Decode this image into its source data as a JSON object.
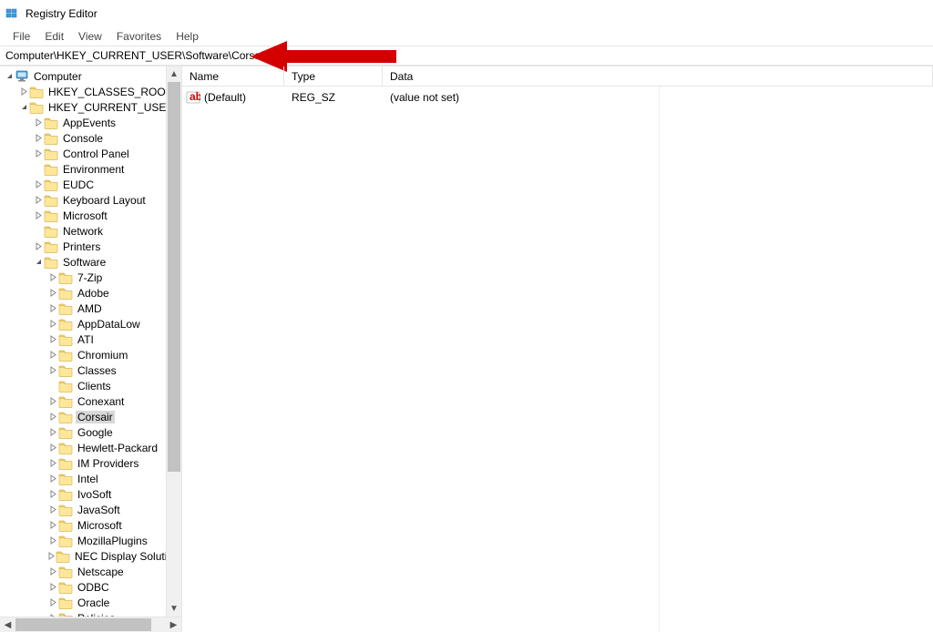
{
  "titlebar": {
    "title": "Registry Editor"
  },
  "menubar": {
    "file": "File",
    "edit": "Edit",
    "view": "View",
    "favorites": "Favorites",
    "help": "Help"
  },
  "addressbar": {
    "path": "Computer\\HKEY_CURRENT_USER\\Software\\Corsair"
  },
  "tree": [
    {
      "level": 0,
      "exp": "v",
      "icon": "computer",
      "label": "Computer"
    },
    {
      "level": 1,
      "exp": ">",
      "icon": "folder",
      "label": "HKEY_CLASSES_ROOT"
    },
    {
      "level": 1,
      "exp": "v",
      "icon": "folder",
      "label": "HKEY_CURRENT_USER"
    },
    {
      "level": 2,
      "exp": ">",
      "icon": "folder",
      "label": "AppEvents"
    },
    {
      "level": 2,
      "exp": ">",
      "icon": "folder",
      "label": "Console"
    },
    {
      "level": 2,
      "exp": ">",
      "icon": "folder",
      "label": "Control Panel"
    },
    {
      "level": 2,
      "exp": " ",
      "icon": "folder",
      "label": "Environment"
    },
    {
      "level": 2,
      "exp": ">",
      "icon": "folder",
      "label": "EUDC"
    },
    {
      "level": 2,
      "exp": ">",
      "icon": "folder",
      "label": "Keyboard Layout"
    },
    {
      "level": 2,
      "exp": ">",
      "icon": "folder",
      "label": "Microsoft"
    },
    {
      "level": 2,
      "exp": " ",
      "icon": "folder",
      "label": "Network"
    },
    {
      "level": 2,
      "exp": ">",
      "icon": "folder",
      "label": "Printers"
    },
    {
      "level": 2,
      "exp": "v",
      "icon": "folder",
      "label": "Software"
    },
    {
      "level": 3,
      "exp": ">",
      "icon": "folder",
      "label": "7-Zip"
    },
    {
      "level": 3,
      "exp": ">",
      "icon": "folder",
      "label": "Adobe"
    },
    {
      "level": 3,
      "exp": ">",
      "icon": "folder",
      "label": "AMD"
    },
    {
      "level": 3,
      "exp": ">",
      "icon": "folder",
      "label": "AppDataLow"
    },
    {
      "level": 3,
      "exp": ">",
      "icon": "folder",
      "label": "ATI"
    },
    {
      "level": 3,
      "exp": ">",
      "icon": "folder",
      "label": "Chromium"
    },
    {
      "level": 3,
      "exp": ">",
      "icon": "folder",
      "label": "Classes"
    },
    {
      "level": 3,
      "exp": " ",
      "icon": "folder",
      "label": "Clients"
    },
    {
      "level": 3,
      "exp": ">",
      "icon": "folder",
      "label": "Conexant"
    },
    {
      "level": 3,
      "exp": ">",
      "icon": "folder",
      "label": "Corsair",
      "selected": true
    },
    {
      "level": 3,
      "exp": ">",
      "icon": "folder",
      "label": "Google"
    },
    {
      "level": 3,
      "exp": ">",
      "icon": "folder",
      "label": "Hewlett-Packard"
    },
    {
      "level": 3,
      "exp": ">",
      "icon": "folder",
      "label": "IM Providers"
    },
    {
      "level": 3,
      "exp": ">",
      "icon": "folder",
      "label": "Intel"
    },
    {
      "level": 3,
      "exp": ">",
      "icon": "folder",
      "label": "IvoSoft"
    },
    {
      "level": 3,
      "exp": ">",
      "icon": "folder",
      "label": "JavaSoft"
    },
    {
      "level": 3,
      "exp": ">",
      "icon": "folder",
      "label": "Microsoft"
    },
    {
      "level": 3,
      "exp": ">",
      "icon": "folder",
      "label": "MozillaPlugins"
    },
    {
      "level": 3,
      "exp": ">",
      "icon": "folder",
      "label": "NEC Display Solutions"
    },
    {
      "level": 3,
      "exp": ">",
      "icon": "folder",
      "label": "Netscape"
    },
    {
      "level": 3,
      "exp": ">",
      "icon": "folder",
      "label": "ODBC"
    },
    {
      "level": 3,
      "exp": ">",
      "icon": "folder",
      "label": "Oracle"
    },
    {
      "level": 3,
      "exp": ">",
      "icon": "folder",
      "label": "Policies"
    }
  ],
  "list": {
    "columns": {
      "name": "Name",
      "type": "Type",
      "data": "Data"
    },
    "rows": [
      {
        "name": "(Default)",
        "type": "REG_SZ",
        "data": "(value not set)"
      }
    ]
  }
}
